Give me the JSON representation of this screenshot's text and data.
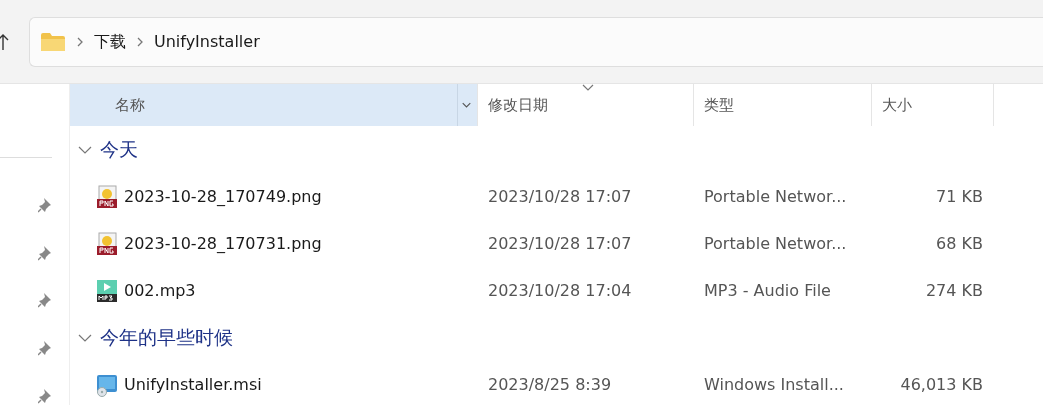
{
  "breadcrumb": [
    "下载",
    "UnifyInstaller"
  ],
  "columns": [
    {
      "label": "名称",
      "highlighted": true,
      "sorted": false
    },
    {
      "label": "修改日期",
      "highlighted": false,
      "sorted": true
    },
    {
      "label": "类型",
      "highlighted": false,
      "sorted": false
    },
    {
      "label": "大小",
      "highlighted": false,
      "sorted": false
    }
  ],
  "groups": [
    {
      "label": "今天",
      "expanded": true,
      "files": [
        {
          "kind": "png",
          "name": "2023-10-28_170749.png",
          "date": "2023/10/28 17:07",
          "type": "Portable Networ...",
          "size": "71 KB"
        },
        {
          "kind": "png",
          "name": "2023-10-28_170731.png",
          "date": "2023/10/28 17:07",
          "type": "Portable Networ...",
          "size": "68 KB"
        },
        {
          "kind": "mp3",
          "name": "002.mp3",
          "date": "2023/10/28 17:04",
          "type": "MP3 - Audio File",
          "size": "274 KB"
        }
      ]
    },
    {
      "label": "今年的早些时候",
      "expanded": true,
      "files": [
        {
          "kind": "msi",
          "name": "UnifyInstaller.msi",
          "date": "2023/8/25 8:39",
          "type": "Windows Install...",
          "size": "46,013 KB"
        }
      ]
    }
  ]
}
